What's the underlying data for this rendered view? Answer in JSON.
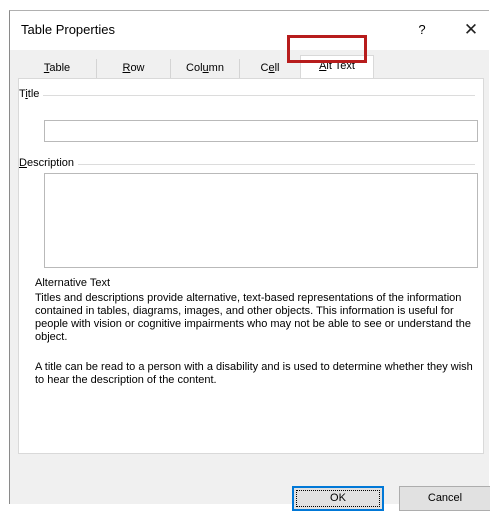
{
  "dialog": {
    "title": "Table Properties",
    "help_label": "?",
    "close_label": "✕"
  },
  "tabs": [
    {
      "pre": "",
      "key": "T",
      "post": "able"
    },
    {
      "pre": "",
      "key": "R",
      "post": "ow"
    },
    {
      "pre": "Col",
      "key": "u",
      "post": "mn"
    },
    {
      "pre": "C",
      "key": "e",
      "post": "ll"
    },
    {
      "pre": "",
      "key": "A",
      "post": "lt Text"
    }
  ],
  "active_tab": "Alt Text",
  "fields": {
    "title": {
      "pre": "T",
      "key": "i",
      "post": "tle",
      "value": ""
    },
    "description": {
      "pre": "",
      "key": "D",
      "post": "escription",
      "value": ""
    }
  },
  "help": {
    "heading": "Alternative Text",
    "paragraph1": "Titles and descriptions provide alternative, text-based representations of the information contained in tables, diagrams, images, and other objects. This information is useful for people with vision or cognitive impairments who may not be able to see or understand the object.",
    "paragraph2": "A title can be read to a person with a disability and is used to determine whether they wish to hear the description of the content."
  },
  "buttons": {
    "ok": "OK",
    "cancel": "Cancel"
  },
  "colors": {
    "highlight": "#b71c1c",
    "default_button_border": "#0078d7"
  }
}
